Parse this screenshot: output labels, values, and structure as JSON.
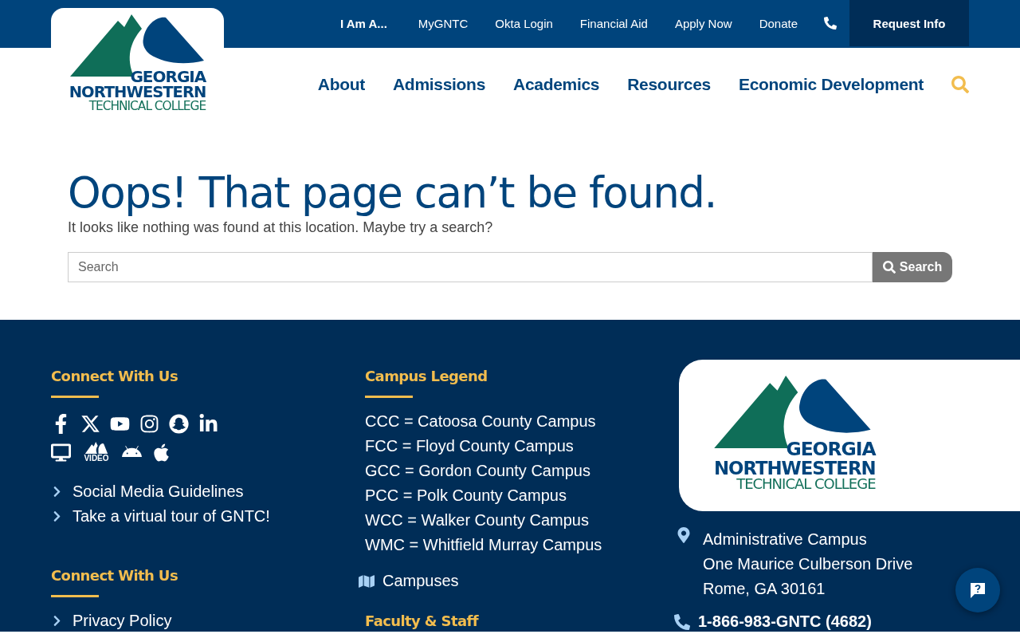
{
  "top_bar": {
    "links": [
      {
        "label": "I Am A...",
        "kind": "menu"
      },
      {
        "label": "MyGNTC",
        "kind": "link"
      },
      {
        "label": "Okta Login",
        "kind": "link"
      },
      {
        "label": "Financial Aid",
        "kind": "link"
      },
      {
        "label": "Apply Now",
        "kind": "link"
      },
      {
        "label": "Donate",
        "kind": "link"
      }
    ],
    "request_button": "Request Info"
  },
  "logo": {
    "lines": [
      "GEORGIA",
      "NORTHWESTERN",
      "TECHNICAL COLLEGE"
    ]
  },
  "main_nav": [
    "About",
    "Admissions",
    "Academics",
    "Resources",
    "Economic Development"
  ],
  "error": {
    "title": "Oops! That page can’t be found.",
    "message": "It looks like nothing was found at this location. Maybe try a search?"
  },
  "search": {
    "placeholder": "Search",
    "button": "Search"
  },
  "footer": {
    "connect": {
      "heading": "Connect With Us",
      "video_label": "VIDEO",
      "links": [
        "Social Media Guidelines",
        "Take a virtual tour of GNTC!"
      ]
    },
    "connect_2": {
      "heading": "Connect With Us",
      "links": [
        "Privacy Policy"
      ]
    },
    "legend": {
      "heading": "Campus Legend",
      "lines": [
        "CCC = Catoosa County Campus",
        "FCC = Floyd County Campus",
        "GCC = Gordon County Campus",
        "PCC = Polk County Campus",
        "WCC = Walker County Campus",
        "WMC = Whitfield Murray Campus"
      ],
      "campuses_link": "Campuses"
    },
    "faculty": {
      "heading": "Faculty & Staff"
    },
    "logo": {
      "lines": [
        "GEORGIA",
        "NORTHWESTERN",
        "TECHNICAL COLLEGE"
      ]
    },
    "address": [
      "Administrative Campus",
      "One Maurice Culberson Drive",
      "Rome, GA 30161"
    ],
    "phone": "1-866-983-GNTC (4682)"
  }
}
